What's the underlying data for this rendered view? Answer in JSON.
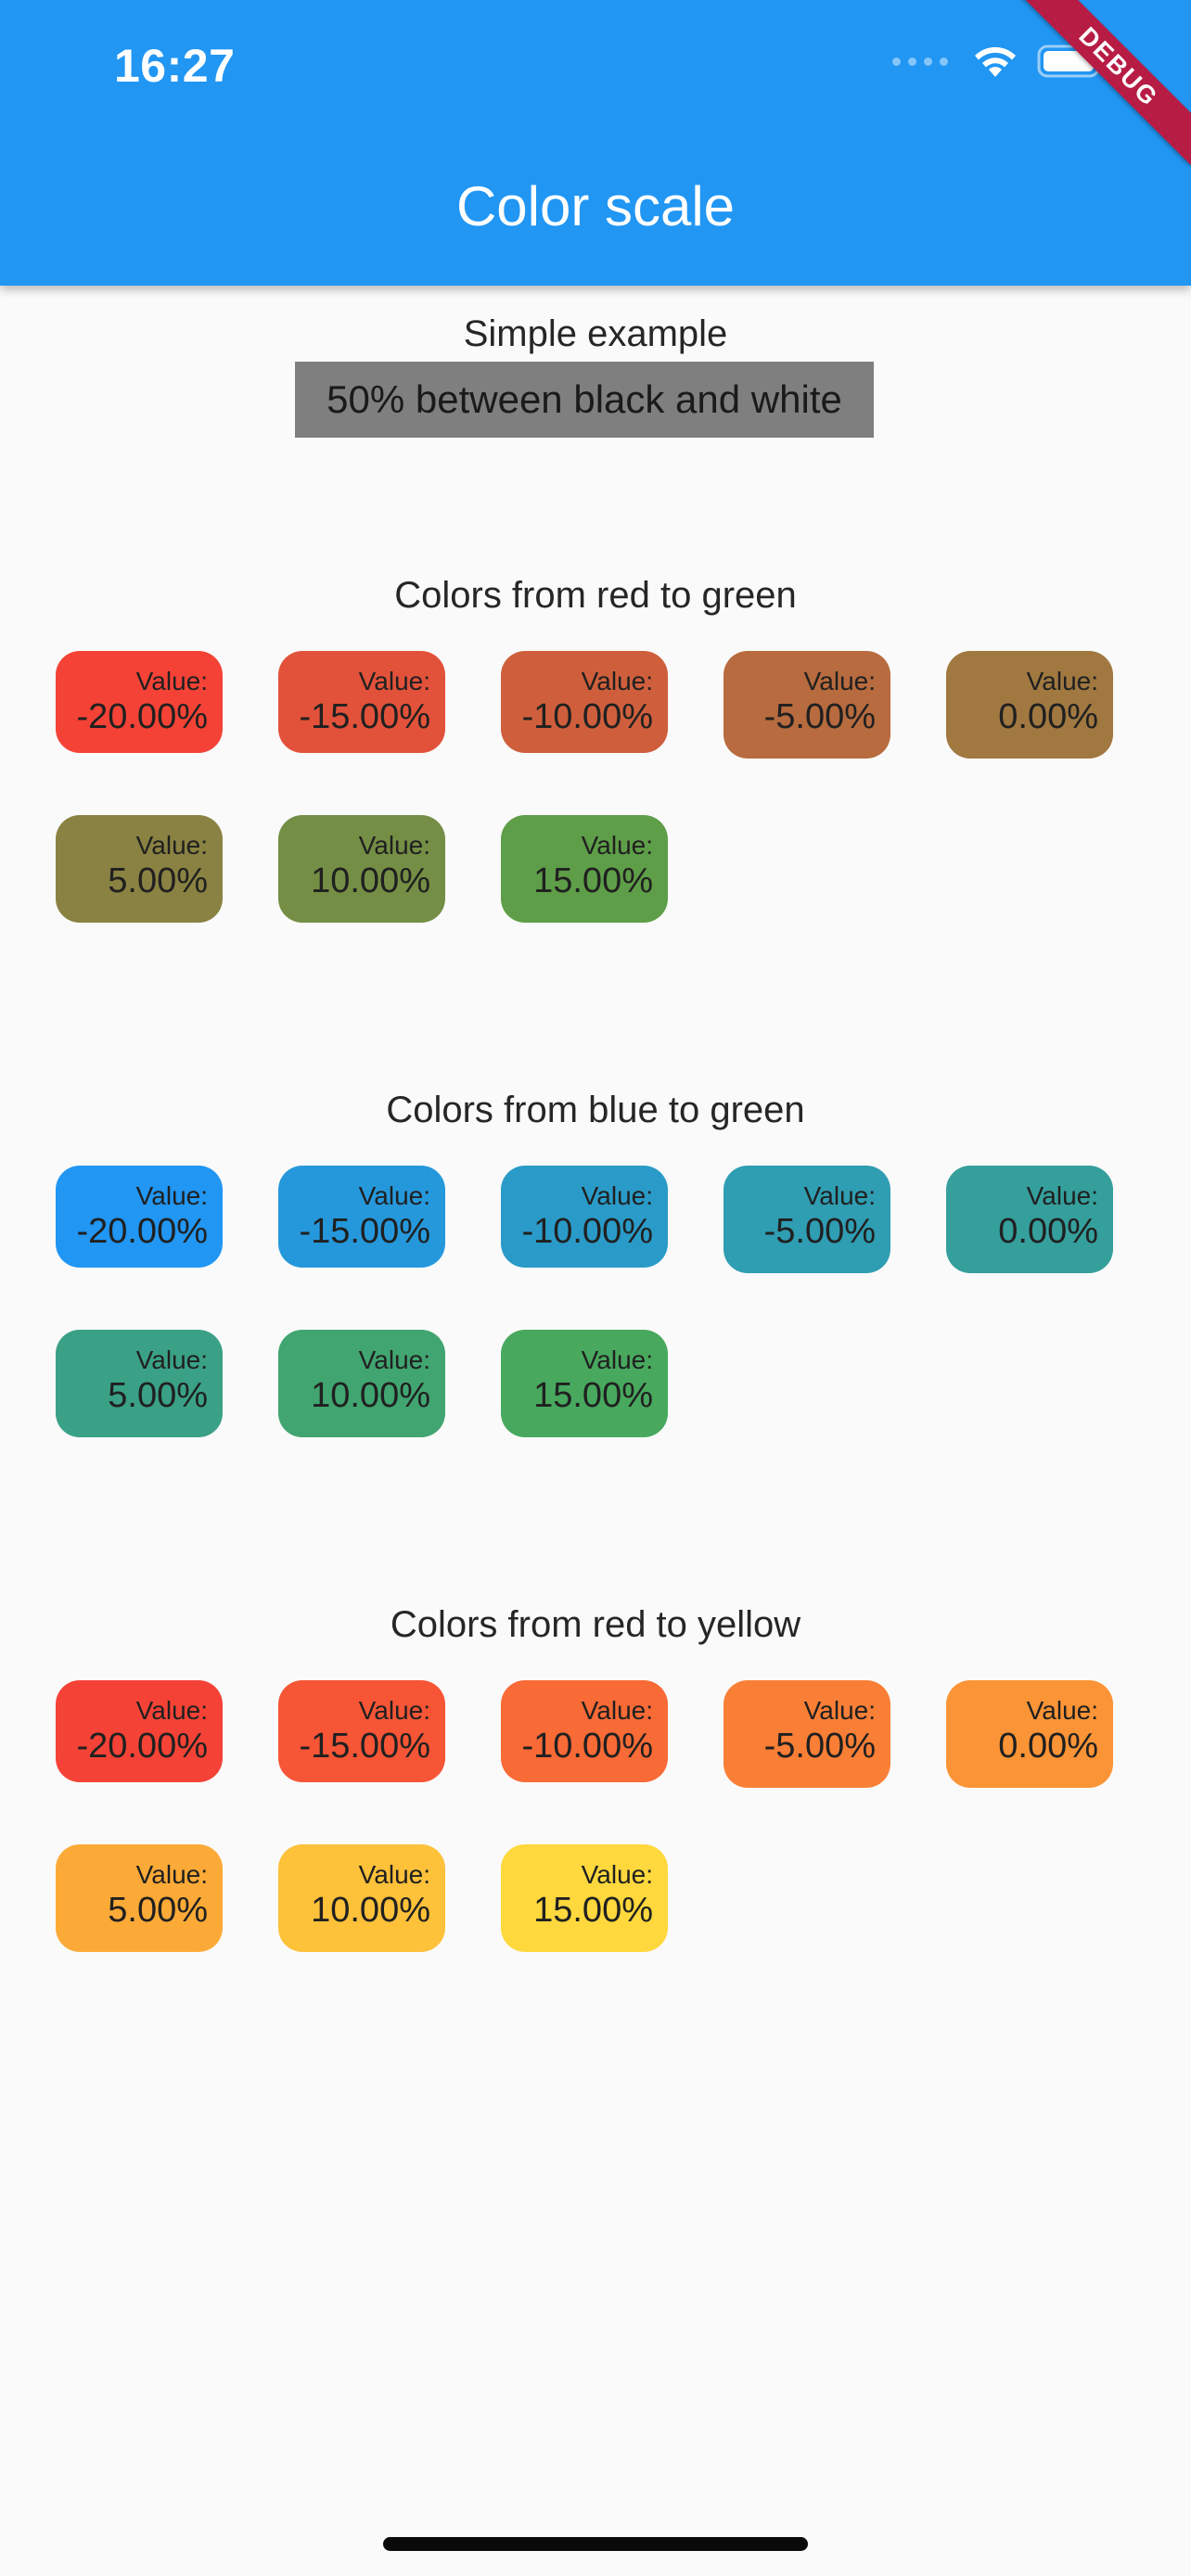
{
  "status_bar": {
    "time": "16:27"
  },
  "debug_banner": "DEBUG",
  "app_bar": {
    "title": "Color scale"
  },
  "simple_example": {
    "title": "Simple example",
    "box_text": "50% between black and white",
    "box_color": "#7f7f7f"
  },
  "sections": [
    {
      "title": "Colors from red to green",
      "chips": [
        {
          "label": "Value:",
          "value": "-20.00%",
          "color": "#f44336"
        },
        {
          "label": "Value:",
          "value": "-15.00%",
          "color": "#e2523a"
        },
        {
          "label": "Value:",
          "value": "-10.00%",
          "color": "#cf5f3c"
        },
        {
          "label": "Value:",
          "value": "-5.00%",
          "color": "#b76b3e"
        },
        {
          "label": "Value:",
          "value": "0.00%",
          "color": "#a07840"
        },
        {
          "label": "Value:",
          "value": "5.00%",
          "color": "#8a8242"
        },
        {
          "label": "Value:",
          "value": "10.00%",
          "color": "#748e45"
        },
        {
          "label": "Value:",
          "value": "15.00%",
          "color": "#5e9e48"
        }
      ]
    },
    {
      "title": "Colors from blue to green",
      "chips": [
        {
          "label": "Value:",
          "value": "-20.00%",
          "color": "#2196f3"
        },
        {
          "label": "Value:",
          "value": "-15.00%",
          "color": "#2598dc"
        },
        {
          "label": "Value:",
          "value": "-10.00%",
          "color": "#2a9bc8"
        },
        {
          "label": "Value:",
          "value": "-5.00%",
          "color": "#2f9db2"
        },
        {
          "label": "Value:",
          "value": "0.00%",
          "color": "#359f9c"
        },
        {
          "label": "Value:",
          "value": "5.00%",
          "color": "#3aa186"
        },
        {
          "label": "Value:",
          "value": "10.00%",
          "color": "#41a571"
        },
        {
          "label": "Value:",
          "value": "15.00%",
          "color": "#48a95e"
        }
      ]
    },
    {
      "title": "Colors from red to yellow",
      "chips": [
        {
          "label": "Value:",
          "value": "-20.00%",
          "color": "#f44336"
        },
        {
          "label": "Value:",
          "value": "-15.00%",
          "color": "#f65536"
        },
        {
          "label": "Value:",
          "value": "-10.00%",
          "color": "#f86a36"
        },
        {
          "label": "Value:",
          "value": "-5.00%",
          "color": "#fa7f36"
        },
        {
          "label": "Value:",
          "value": "0.00%",
          "color": "#fb9436"
        },
        {
          "label": "Value:",
          "value": "5.00%",
          "color": "#fcaa37"
        },
        {
          "label": "Value:",
          "value": "10.00%",
          "color": "#fdc13a"
        },
        {
          "label": "Value:",
          "value": "15.00%",
          "color": "#fed83d"
        }
      ]
    }
  ]
}
